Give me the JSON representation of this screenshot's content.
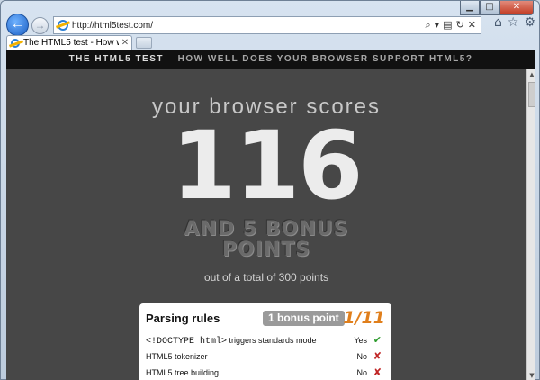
{
  "browser": {
    "window_controls": {
      "minimize": "▁",
      "maximize": "□",
      "close": "✕"
    },
    "address": "http://html5test.com/",
    "address_icons": [
      "⌕",
      "▾",
      "▤",
      "↻",
      "✕"
    ],
    "right_icons": [
      "⌂",
      "☆",
      "⚙"
    ],
    "tab": {
      "title": "The HTML5 test - How we...",
      "close": "✕"
    }
  },
  "site": {
    "brand": "THE HTML5 TEST",
    "tagline": " – HOW WELL DOES YOUR BROWSER SUPPORT HTML5?"
  },
  "score": {
    "heading": "your browser scores",
    "value": "116",
    "bonus_line1": "AND 5 BONUS",
    "bonus_line2": "POINTS",
    "total": "out of a total of 300 points"
  },
  "section": {
    "title": "Parsing rules",
    "bonus": "1 bonus point",
    "ratio": "1/11",
    "rows": [
      {
        "code": "<!DOCTYPE html>",
        "text": " triggers standards mode",
        "result": "Yes",
        "mark": "✔",
        "status": "ok"
      },
      {
        "code": "",
        "text": "HTML5 tokenizer",
        "result": "No",
        "mark": "✘",
        "status": "bad"
      },
      {
        "code": "",
        "text": "HTML5 tree building",
        "result": "No",
        "mark": "✘",
        "status": "bad"
      }
    ]
  },
  "scrollbar": {
    "up": "▲",
    "down": "▼"
  }
}
